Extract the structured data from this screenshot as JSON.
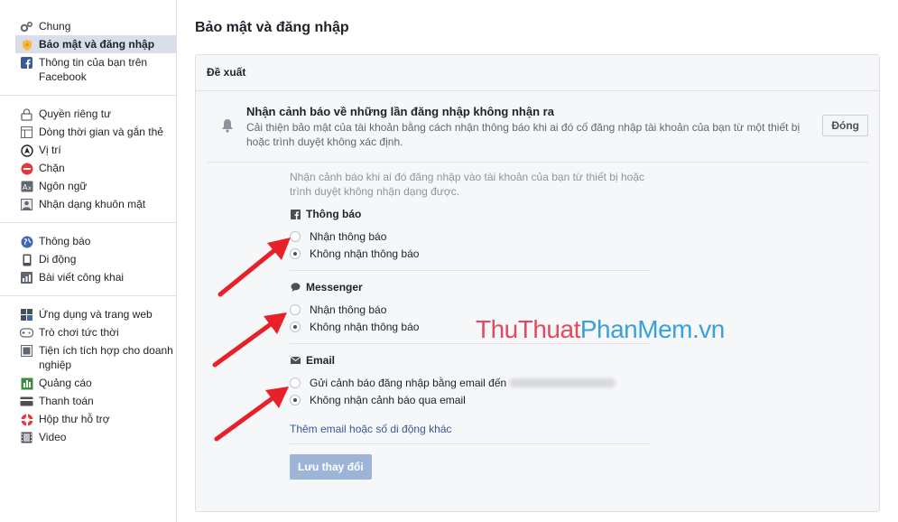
{
  "sidebar": {
    "group1": [
      {
        "label": "Chung",
        "icon": "gears-icon"
      },
      {
        "label": "Bảo mật và đăng nhập",
        "icon": "shield-icon",
        "active": true
      },
      {
        "label": "Thông tin của bạn trên Facebook",
        "icon": "facebook-icon"
      }
    ],
    "group2": [
      {
        "label": "Quyền riêng tư",
        "icon": "lock-icon"
      },
      {
        "label": "Dòng thời gian và gắn thẻ",
        "icon": "timeline-icon"
      },
      {
        "label": "Vị trí",
        "icon": "location-icon"
      },
      {
        "label": "Chặn",
        "icon": "block-icon"
      },
      {
        "label": "Ngôn ngữ",
        "icon": "language-icon"
      },
      {
        "label": "Nhận dạng khuôn mặt",
        "icon": "face-icon"
      }
    ],
    "group3": [
      {
        "label": "Thông báo",
        "icon": "globe-icon"
      },
      {
        "label": "Di động",
        "icon": "mobile-icon"
      },
      {
        "label": "Bài viết công khai",
        "icon": "rss-icon"
      }
    ],
    "group4": [
      {
        "label": "Ứng dụng và trang web",
        "icon": "apps-icon"
      },
      {
        "label": "Trò chơi tức thời",
        "icon": "gamepad-icon"
      },
      {
        "label": "Tiện ích tích hợp cho doanh nghiệp",
        "icon": "integration-icon"
      },
      {
        "label": "Quảng cáo",
        "icon": "ads-icon"
      },
      {
        "label": "Thanh toán",
        "icon": "payment-icon"
      },
      {
        "label": "Hộp thư hỗ trợ",
        "icon": "lifebuoy-icon"
      },
      {
        "label": "Video",
        "icon": "film-icon"
      }
    ]
  },
  "main": {
    "title": "Bảo mật và đăng nhập",
    "card_header": "Đề xuất",
    "recommendation": {
      "title": "Nhận cảnh báo về những lần đăng nhập không nhận ra",
      "description": "Cải thiện bảo mật của tài khoản bằng cách nhận thông báo khi ai đó cố đăng nhập tài khoản của bạn từ một thiết bị hoặc trình duyệt không xác định.",
      "dismiss_label": "Đóng"
    },
    "intro": "Nhận cảnh báo khi ai đó đăng nhập vào tài khoản của bạn từ thiết bị hoặc trình duyệt không nhận dạng được.",
    "sections": {
      "notifications": {
        "heading": "Thông báo",
        "option_on": "Nhận thông báo",
        "option_off": "Không nhận thông báo",
        "selected": "off"
      },
      "messenger": {
        "heading": "Messenger",
        "option_on": "Nhận thông báo",
        "option_off": "Không nhận thông báo",
        "selected": "off"
      },
      "email": {
        "heading": "Email",
        "option_on": "Gửi cảnh báo đăng nhập bằng email đến",
        "option_off": "Không nhận cảnh báo qua email",
        "selected": "off"
      }
    },
    "add_contact_link": "Thêm email hoặc số di động khác",
    "save_label": "Lưu thay đổi"
  },
  "watermark": {
    "part1": "ThuThuat",
    "part2": "PhanMem.vn"
  },
  "colors": {
    "arrow": "#e8202a",
    "link": "#365899",
    "active_bg": "#d8dfea",
    "save_bg": "#9cb4d8"
  }
}
